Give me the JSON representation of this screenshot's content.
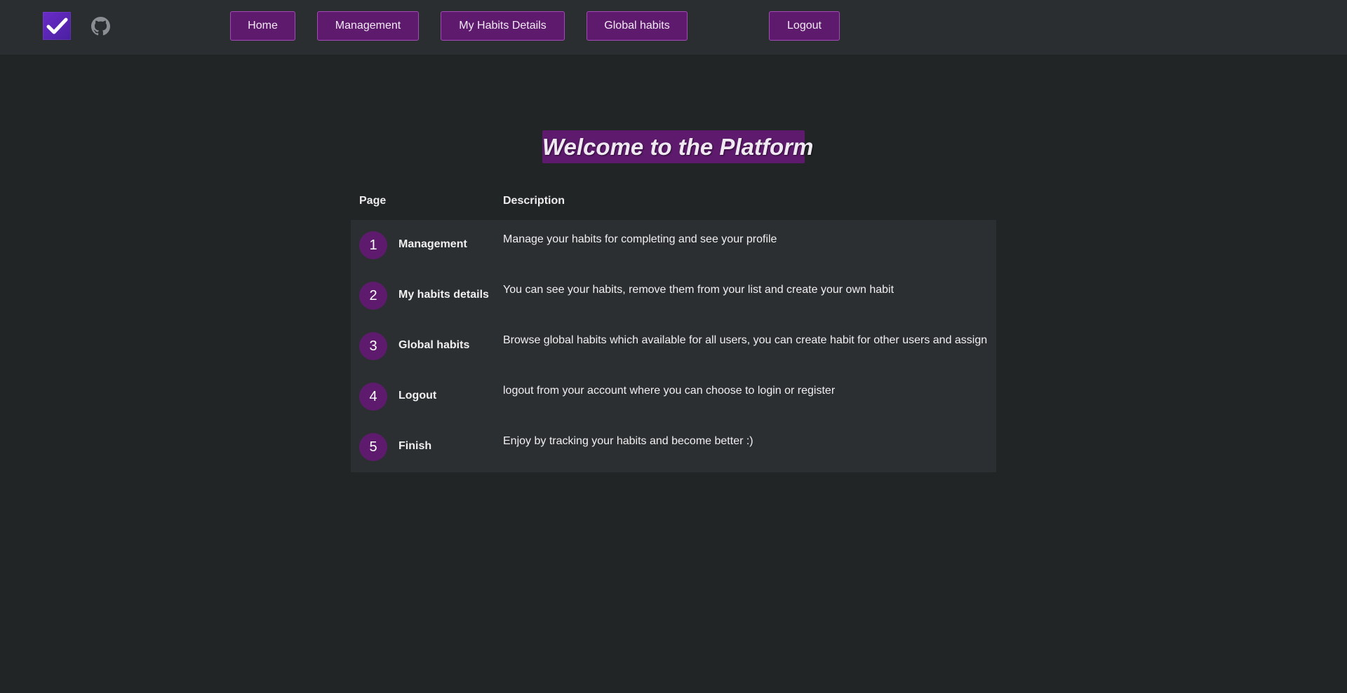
{
  "nav": {
    "logo_icon": "checkmark-logo-icon",
    "github_icon": "github-icon",
    "items": [
      {
        "label": "Home"
      },
      {
        "label": "Management"
      },
      {
        "label": "My Habits Details"
      },
      {
        "label": "Global habits"
      },
      {
        "label": "Logout"
      }
    ]
  },
  "main": {
    "title": "Welcome to the Platform",
    "table": {
      "headers": {
        "page": "Page",
        "description": "Description"
      },
      "rows": [
        {
          "num": "1",
          "page": "Management",
          "description": "Manage your habits for completing and see your profile"
        },
        {
          "num": "2",
          "page": "My habits details",
          "description": "You can see your habits, remove them from your list and create your own habit"
        },
        {
          "num": "3",
          "page": "Global habits",
          "description": "Browse global habits which available for all users, you can create habit for other users and assign"
        },
        {
          "num": "4",
          "page": "Logout",
          "description": "logout from your account where you can choose to login or register"
        },
        {
          "num": "5",
          "page": "Finish",
          "description": "Enjoy by tracking your habits and become better :)"
        }
      ]
    }
  },
  "colors": {
    "background": "#222526",
    "navbar": "#2b2e31",
    "accent_purple": "#5e1b6d",
    "button_border": "#a24bb6",
    "table_body": "#2c2f32"
  }
}
